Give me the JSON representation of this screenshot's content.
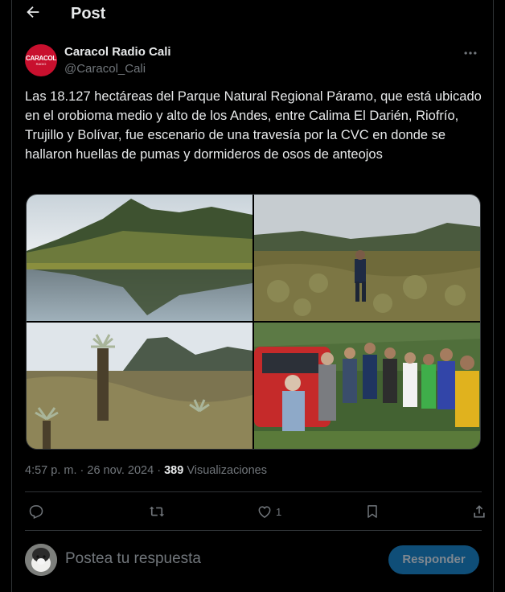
{
  "header": {
    "title": "Post",
    "back_icon": "arrow-left-icon"
  },
  "author": {
    "name": "Caracol Radio Cali",
    "handle": "@Caracol_Cali",
    "avatar_text": "CARACOL",
    "avatar_subtext": "RADIO",
    "more_icon": "more-horizontal-icon"
  },
  "post": {
    "text": "Las 18.127 hectáreas del Parque Natural Regional Páramo, que está ubicado en el orobioma medio y alto de los Andes, entre Calima El Darién, Riofrío, Trujillo y Bolívar, fue escenario de una travesía por la CVC en donde se hallaron huellas de pumas y dormideros de osos de anteojos",
    "time": "4:57 p. m.",
    "separator": "·",
    "date": "26 nov. 2024",
    "views_count": "389",
    "views_label": "Visualizaciones"
  },
  "actions": {
    "reply_icon": "reply-icon",
    "repost_icon": "repost-icon",
    "like_icon": "heart-icon",
    "like_count": "1",
    "bookmark_icon": "bookmark-icon",
    "share_icon": "share-icon"
  },
  "reply_box": {
    "placeholder": "Postea tu respuesta",
    "button_label": "Responder"
  },
  "colors": {
    "background": "#000000",
    "text": "#e7e9ea",
    "muted": "#71767b",
    "border": "#2f3336",
    "brand_red": "#c8102e",
    "button_disabled": "#0f4e78"
  }
}
